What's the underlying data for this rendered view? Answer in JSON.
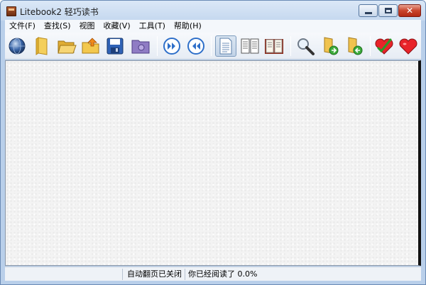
{
  "window": {
    "title": "Litebook2 轻巧读书",
    "close_symbol": "✕"
  },
  "menu": {
    "items": [
      "文件(F)",
      "查找(S)",
      "视图",
      "收藏(V)",
      "工具(T)",
      "帮助(H)"
    ]
  },
  "toolbar": {
    "buttons": [
      "globe-icon",
      "library-icon",
      "open-folder-icon",
      "folder-up-icon",
      "save-icon",
      "purple-folder-icon",
      "page-forward-icon",
      "page-back-icon",
      "single-page-view-icon",
      "two-page-view-icon",
      "book-view-icon",
      "search-icon",
      "folder-next-icon",
      "folder-prev-icon",
      "add-bookmark-heart-icon",
      "bookmark-heart-icon"
    ],
    "pressed": "single-page-view-icon"
  },
  "statusbar": {
    "auto_page": "自动翻页已关闭",
    "read_progress": "你已经阅读了 0.0%"
  },
  "colors": {
    "titlebar": "#c5d8ef",
    "close_button": "#c9452d",
    "client_background": "#f3f3f3"
  }
}
